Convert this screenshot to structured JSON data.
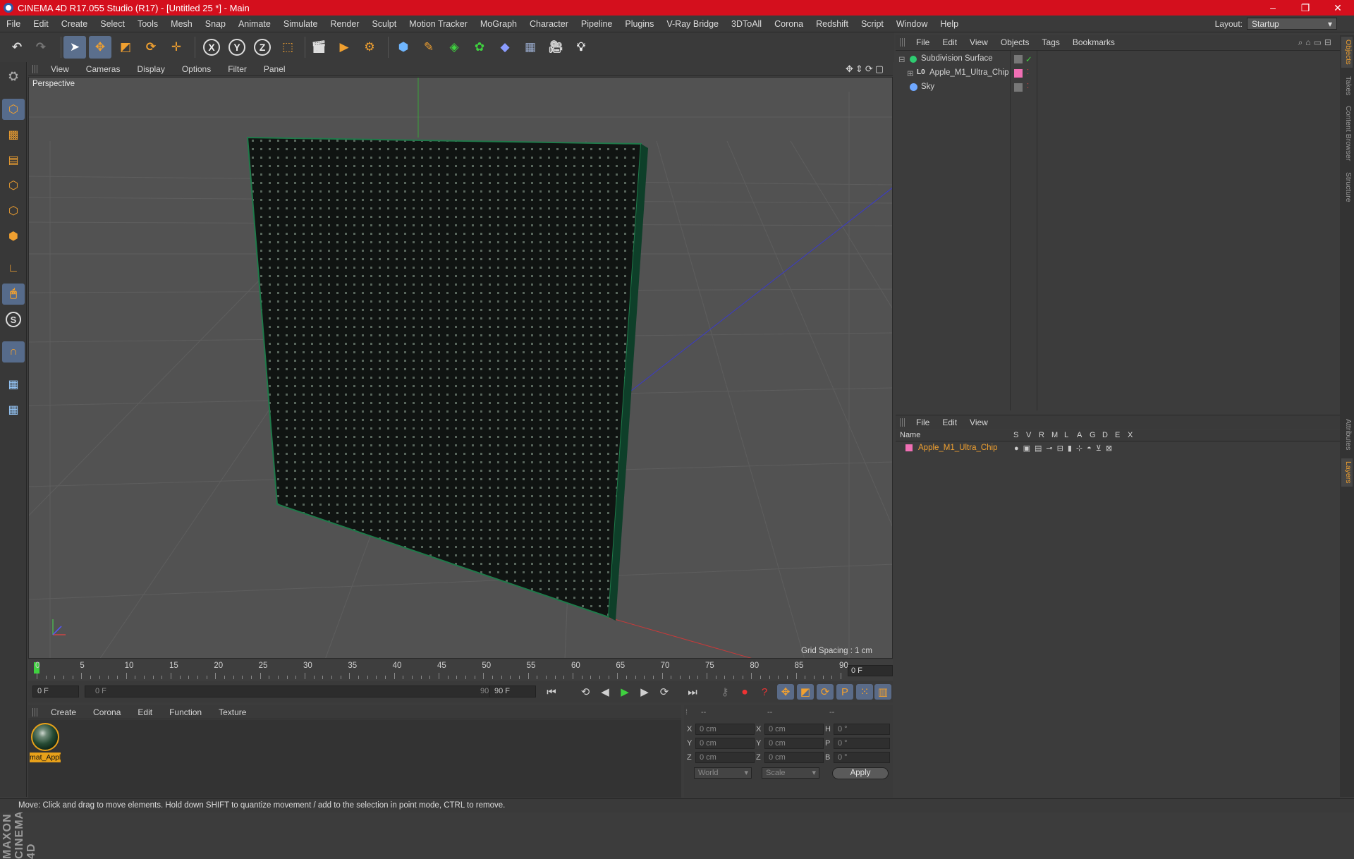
{
  "window": {
    "title": "CINEMA 4D R17.055 Studio (R17) - [Untitled 25 *] - Main",
    "controls": [
      "–",
      "❐",
      "✕"
    ]
  },
  "menubar": {
    "items": [
      "File",
      "Edit",
      "Create",
      "Select",
      "Tools",
      "Mesh",
      "Snap",
      "Animate",
      "Simulate",
      "Render",
      "Sculpt",
      "Motion Tracker",
      "MoGraph",
      "Character",
      "Pipeline",
      "Plugins",
      "V-Ray Bridge",
      "3DToAll",
      "Corona",
      "Redshift",
      "Script",
      "Window",
      "Help"
    ],
    "layout_label": "Layout:",
    "layout_value": "Startup"
  },
  "toolbar": {
    "axis": [
      "X",
      "Y",
      "Z"
    ]
  },
  "viewport": {
    "menu": [
      "View",
      "Cameras",
      "Display",
      "Options",
      "Filter",
      "Panel"
    ],
    "label": "Perspective",
    "grid_spacing": "Grid Spacing : 1 cm",
    "navs": "✥⇕⟳▢"
  },
  "timeline": {
    "labels": [
      "0",
      "5",
      "10",
      "15",
      "20",
      "25",
      "30",
      "35",
      "40",
      "45",
      "50",
      "55",
      "60",
      "65",
      "70",
      "75",
      "80",
      "85",
      "90"
    ],
    "end_frame": "0 F"
  },
  "transport": {
    "current_frame": "0 F",
    "range_start": "0 F",
    "range_end": "90 F",
    "max_frame": "90 F"
  },
  "material_manager": {
    "menu": [
      "Create",
      "Corona",
      "Edit",
      "Function",
      "Texture"
    ],
    "material_label": "mat_Appl"
  },
  "coordinates": {
    "header": [
      "--",
      "--",
      "--"
    ],
    "rows": [
      {
        "a": "X",
        "av": "0 cm",
        "b": "X",
        "bv": "0 cm",
        "c": "H",
        "cv": "0 °"
      },
      {
        "a": "Y",
        "av": "0 cm",
        "b": "Y",
        "bv": "0 cm",
        "c": "P",
        "cv": "0 °"
      },
      {
        "a": "Z",
        "av": "0 cm",
        "b": "Z",
        "bv": "0 cm",
        "c": "B",
        "cv": "0 °"
      }
    ],
    "mode1": "World",
    "mode2": "Scale",
    "apply": "Apply"
  },
  "object_manager": {
    "menu": [
      "File",
      "Edit",
      "View",
      "Objects",
      "Tags",
      "Bookmarks"
    ],
    "objects": [
      {
        "name": "Subdivision Surface",
        "color": "#2ecc71"
      },
      {
        "name": "Apple_M1_Ultra_Chip",
        "color": "#f06fb4"
      },
      {
        "name": "Sky",
        "color": "#6fa8ff"
      }
    ]
  },
  "layer_manager": {
    "menu": [
      "File",
      "Edit",
      "View"
    ],
    "columns": [
      "Name",
      "S",
      "V",
      "R",
      "M",
      "L",
      "A",
      "G",
      "D",
      "E",
      "X"
    ],
    "layers": [
      {
        "name": "Apple_M1_Ultra_Chip",
        "color": "#f06fb4"
      }
    ]
  },
  "side_tabs": [
    "Objects",
    "Takes",
    "Content Browser",
    "Structure",
    "Attributes",
    "Layers"
  ],
  "brand": "MAXON CINEMA 4D",
  "statusbar": {
    "text": "Move: Click and drag to move elements. Hold down SHIFT to quantize movement / add to the selection in point mode, CTRL to remove."
  },
  "colors": {
    "titlebar": "#d40f1d",
    "accent": "#f0a030",
    "selected_tool": "#5b6f8d"
  }
}
